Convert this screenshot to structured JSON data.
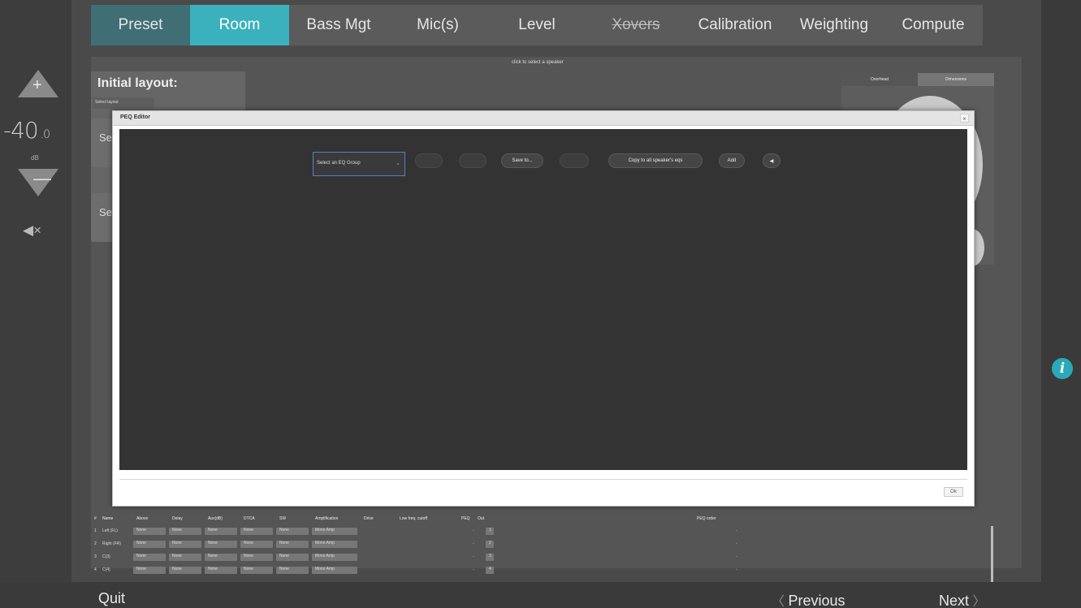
{
  "tabs": [
    {
      "label": "Preset"
    },
    {
      "label": "Room"
    },
    {
      "label": "Bass Mgt"
    },
    {
      "label": "Mic(s)"
    },
    {
      "label": "Level"
    },
    {
      "label": "Xovers"
    },
    {
      "label": "Calibration"
    },
    {
      "label": "Weighting"
    },
    {
      "label": "Compute"
    }
  ],
  "active_tab": "Room",
  "volume": {
    "value": "-40",
    "decimal": ".0",
    "unit": "dB",
    "up_icon": "plus-icon",
    "down_icon": "minus-icon",
    "mute_icon": "speaker-mute-icon"
  },
  "room": {
    "hint": "click to select a speaker",
    "initial_layout_title": "Initial layout:",
    "select_layout": "Select layout",
    "side_btn_1": "Se",
    "side_btn_2": "Se",
    "view_toggle": [
      "Overhead",
      "Dimensions"
    ]
  },
  "modal": {
    "title": "PEQ Editor",
    "close_label": "×",
    "select_placeholder": "Select an EQ Group",
    "buttons": {
      "save": "Save to...",
      "copy_all": "Copy to all speaker's eqs",
      "add": "Add",
      "speaker": "◀"
    },
    "ok_label": "Ok"
  },
  "table": {
    "headers": [
      "#",
      "Name",
      "Above",
      "Delay",
      "Aux(dB)",
      "DTCA",
      "SW",
      "Amplification",
      "Drive",
      "Low freq. cutoff",
      "PEQ",
      "Out"
    ],
    "peq_header": "PEQ order",
    "rows": [
      {
        "n": "1",
        "name": "Left (FL)",
        "above": "None",
        "delay": "None",
        "aux": "None",
        "dtca": "None",
        "sw": "None",
        "amp": "Mono Amp",
        "out": "1"
      },
      {
        "n": "2",
        "name": "Right (FR)",
        "above": "None",
        "delay": "None",
        "aux": "None",
        "dtca": "None",
        "sw": "None",
        "amp": "Mono Amp",
        "out": "2"
      },
      {
        "n": "3",
        "name": "C(3)",
        "above": "None",
        "delay": "None",
        "aux": "None",
        "dtca": "None",
        "sw": "None",
        "amp": "Mono Amp",
        "out": "3"
      },
      {
        "n": "4",
        "name": "C(4)",
        "above": "None",
        "delay": "None",
        "aux": "None",
        "dtca": "None",
        "sw": "None",
        "amp": "Mono Amp",
        "out": "4"
      }
    ]
  },
  "footer": {
    "quit": "Quit",
    "previous": "Previous",
    "next": "Next"
  },
  "info_icon": "info-icon",
  "colors": {
    "accent": "#3ab1bd",
    "preset_tab": "#3f6f74",
    "background": "#3a3a3a",
    "modal_canvas": "#333333"
  }
}
